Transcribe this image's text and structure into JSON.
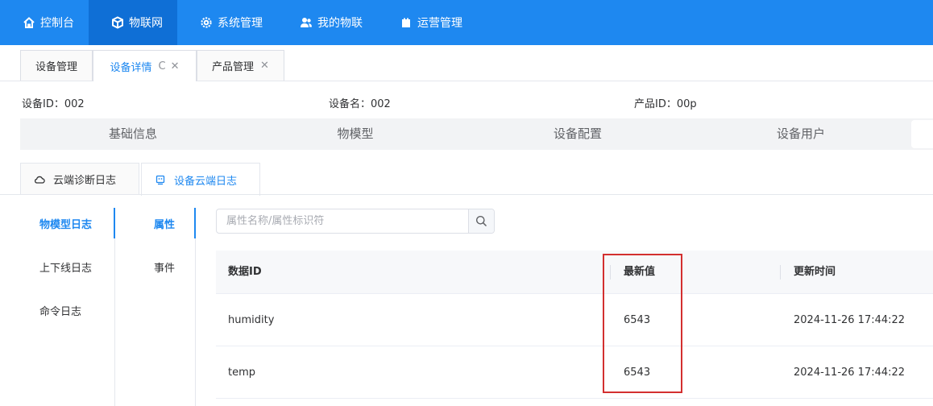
{
  "nav": {
    "items": [
      {
        "label": "控制台",
        "icon": "home-icon"
      },
      {
        "label": "物联网",
        "icon": "cube-icon"
      },
      {
        "label": "系统管理",
        "icon": "gear-icon"
      },
      {
        "label": "我的物联",
        "icon": "user-group-icon"
      },
      {
        "label": "运营管理",
        "icon": "briefcase-icon"
      }
    ],
    "active_index": 1
  },
  "tabs": [
    {
      "label": "设备管理"
    },
    {
      "label": "设备详情",
      "refresh_glyph": "C",
      "close_glyph": "✕"
    },
    {
      "label": "产品管理",
      "close_glyph": "✕"
    }
  ],
  "info": {
    "device_id": "设备ID：002",
    "device_name": "设备名：002",
    "product_id": "产品ID：00p"
  },
  "sections": [
    "基础信息",
    "物模型",
    "设备配置",
    "设备用户"
  ],
  "log_tabs": [
    "云端诊断日志",
    "设备云端日志"
  ],
  "side_menu": [
    "物模型日志",
    "上下线日志",
    "命令日志"
  ],
  "sub_menu": [
    "属性",
    "事件"
  ],
  "search": {
    "placeholder": "属性名称/属性标识符"
  },
  "table": {
    "headers": [
      "数据ID",
      "最新值",
      "更新时间"
    ],
    "rows": [
      [
        "humidity",
        "6543",
        "2024-11-26 17:44:22"
      ],
      [
        "temp",
        "6543",
        "2024-11-26 17:44:22"
      ]
    ]
  },
  "colors": {
    "primary": "#1e88f0",
    "highlight": "#d32f2f"
  }
}
